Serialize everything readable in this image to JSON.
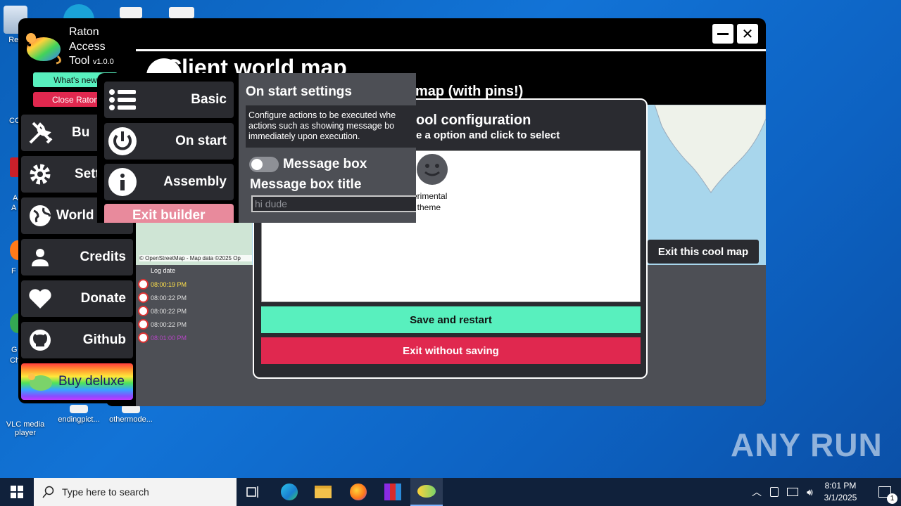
{
  "desktop": {
    "icons": [
      {
        "label": "Rec"
      },
      {
        "label": "VLC media player"
      },
      {
        "label": "endingpict..."
      },
      {
        "label": "othermode..."
      }
    ],
    "edge_labels": [
      "CC",
      "A",
      "A",
      "F",
      "G",
      "Ch"
    ]
  },
  "sidebar": {
    "brand": {
      "line1": "Raton",
      "line2": "Access",
      "line3": "Tool",
      "version": "v1.0.0"
    },
    "whats_new": "What's new",
    "close_rat": "Close Raton",
    "items": [
      {
        "label": "Bu",
        "icon": "tools-icon"
      },
      {
        "label": "Setti",
        "icon": "gear-icon"
      },
      {
        "label": "World",
        "icon": "globe-icon"
      },
      {
        "label": "Credits",
        "icon": "person-icon"
      },
      {
        "label": "Donate",
        "icon": "heart-icon"
      },
      {
        "label": "Github",
        "icon": "github-icon"
      }
    ],
    "deluxe": "Buy deluxe"
  },
  "builder": {
    "items": [
      {
        "label": "Basic",
        "icon": "list-icon"
      },
      {
        "label": "On start",
        "icon": "power-icon"
      },
      {
        "label": "Assembly",
        "icon": "info-icon"
      }
    ],
    "exit": "Exit builder",
    "settings": {
      "title": "On start settings",
      "desc_line1": "Configure actions to be executed whe",
      "desc_line2": "actions such as showing message bo",
      "desc_line3": "immediately upon execution.",
      "toggle_label": "Message box",
      "title_label": "Message box title",
      "title_value": "hi dude"
    }
  },
  "map_window": {
    "title": "Client world map",
    "subtitle": "map (with pins!)",
    "osm_credit": "© OpenStreetMap - Map data ©2025 Op",
    "exit_map": "Exit this cool map",
    "log_header": "Log date",
    "logs": [
      {
        "time": "08:00:19 PM",
        "color": "#ffe14a"
      },
      {
        "time": "08:00:22 PM",
        "color": "#e0e0e0"
      },
      {
        "time": "08:00:22 PM",
        "color": "#e0e0e0"
      },
      {
        "time": "08:00:22 PM",
        "color": "#e0e0e0"
      },
      {
        "time": "08:01:00 PM",
        "color": "#b845c8"
      }
    ]
  },
  "config_dialog": {
    "title": "ool configuration",
    "subtitle": "e a option and click to select",
    "theme_label_line1": "erimental",
    "theme_label_line2": "t theme",
    "save": "Save and restart",
    "exit": "Exit without saving"
  },
  "taskbar": {
    "search_placeholder": "Type here to search",
    "time": "8:01 PM",
    "date": "3/1/2025",
    "notification_count": "1"
  },
  "watermark": "ANY RUN",
  "colors": {
    "accent_green": "#58f0be",
    "accent_red": "#e0284f",
    "panel_dark": "#2a2b30",
    "panel_grey": "#4d4f55"
  }
}
